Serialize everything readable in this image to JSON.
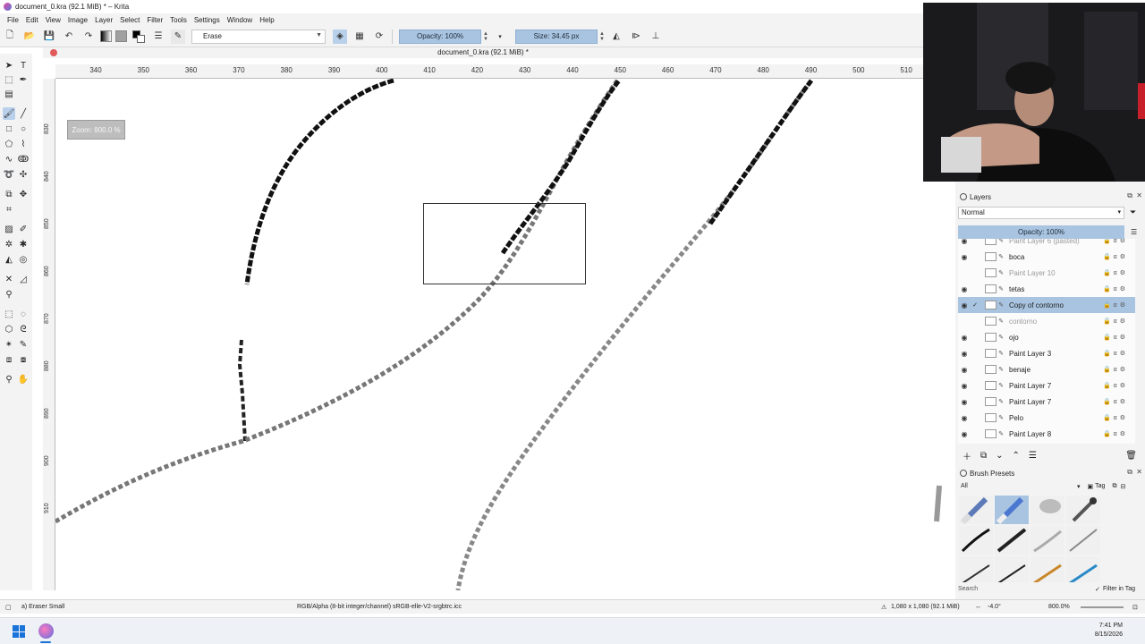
{
  "window": {
    "title": "document_0.kra (92.1 MiB) * – Krita"
  },
  "menu": [
    "File",
    "Edit",
    "View",
    "Image",
    "Layer",
    "Select",
    "Filter",
    "Tools",
    "Settings",
    "Window",
    "Help"
  ],
  "toolbar": {
    "brush_preset": "Erase",
    "opacity": "Opacity: 100%",
    "size": "Size: 34.45 px"
  },
  "document_tab": {
    "title": "document_0.kra (92.1 MiB) *"
  },
  "ruler_top": [
    "340",
    "350",
    "360",
    "370",
    "380",
    "390",
    "400",
    "410",
    "420",
    "430",
    "440",
    "450",
    "460",
    "470",
    "480",
    "490",
    "500",
    "510"
  ],
  "ruler_left": [
    "830",
    "840",
    "850",
    "860",
    "870",
    "880",
    "890",
    "900",
    "910"
  ],
  "canvas": {
    "zoom_tooltip": "Zoom: 800.0 %"
  },
  "layers_panel": {
    "title": "Layers",
    "blend_mode": "Normal",
    "opacity": "Opacity: 100%",
    "layers": [
      {
        "name": "Paint Layer 6 (pasted)",
        "visible": true,
        "selected": false,
        "dim": true
      },
      {
        "name": "boca",
        "visible": true,
        "selected": false,
        "dim": false
      },
      {
        "name": "Paint Layer 10",
        "visible": false,
        "selected": false,
        "dim": true
      },
      {
        "name": "tetas",
        "visible": true,
        "selected": false,
        "dim": false
      },
      {
        "name": "Copy of contorno",
        "visible": true,
        "selected": true,
        "dim": false
      },
      {
        "name": "contorno",
        "visible": false,
        "selected": false,
        "dim": true
      },
      {
        "name": "ojo",
        "visible": true,
        "selected": false,
        "dim": false
      },
      {
        "name": "Paint Layer 3",
        "visible": true,
        "selected": false,
        "dim": false
      },
      {
        "name": "benaje",
        "visible": true,
        "selected": false,
        "dim": false
      },
      {
        "name": "Paint Layer 7",
        "visible": true,
        "selected": false,
        "dim": false
      },
      {
        "name": "Paint Layer 7",
        "visible": true,
        "selected": false,
        "dim": false
      },
      {
        "name": "Pelo",
        "visible": true,
        "selected": false,
        "dim": false
      },
      {
        "name": "Paint Layer 8",
        "visible": true,
        "selected": false,
        "dim": false
      }
    ]
  },
  "brush_presets_panel": {
    "title": "Brush Presets",
    "filter": "All",
    "tag_label": "Tag",
    "search_label": "Search",
    "filter_in_tag": "Filter in Tag"
  },
  "status": {
    "brush": "a) Eraser Small",
    "color_profile": "RGB/Alpha (8-bit integer/channel)  sRGB-elle-V2-srgbtrc.icc",
    "image_size": "1,080 x 1,080 (92.1 MiB)",
    "rotation": "-4.0°",
    "zoom": "800.0%"
  },
  "taskbar": {
    "time": "7:41 PM",
    "date": "8/15/2026"
  },
  "colors": {
    "accent": "#a9c4e0",
    "panel_bg": "#f3f3f3",
    "foreground": "#000000",
    "background": "#ffffff"
  }
}
